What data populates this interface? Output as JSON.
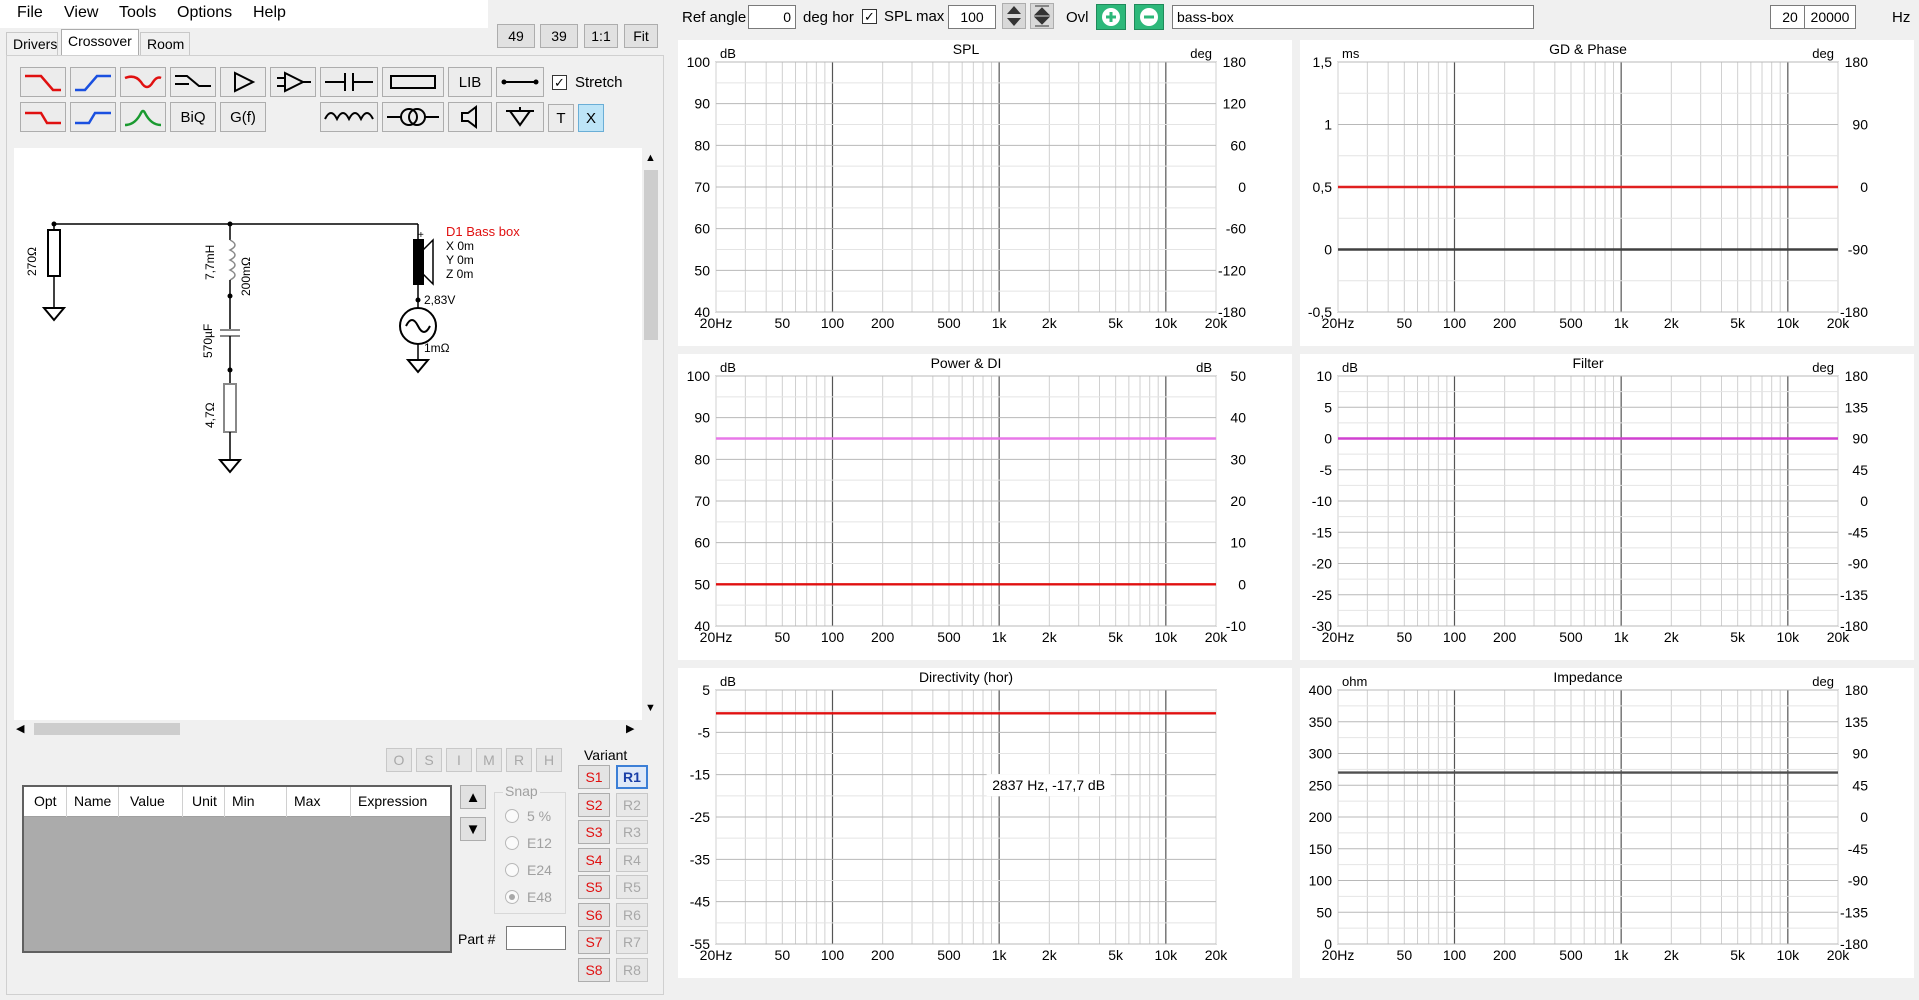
{
  "menu": {
    "file": "File",
    "view": "View",
    "tools": "Tools",
    "options": "Options",
    "help": "Help"
  },
  "tabs": {
    "drivers": "Drivers",
    "crossover": "Crossover",
    "room": "Room"
  },
  "zoom": {
    "z49": "49",
    "z39": "39",
    "one": "1:1",
    "fit": "Fit"
  },
  "toolbar": {
    "lib": "LIB",
    "biq": "BiQ",
    "gf": "G(f)",
    "stretch": "Stretch",
    "t": "T",
    "x": "X"
  },
  "schematic": {
    "r1": "270Ω",
    "l1": "7,7mH",
    "l1_res": "200mΩ",
    "c1": "570µF",
    "r2": "4,7Ω",
    "driver_name": "D1 Bass box",
    "x": "X 0m",
    "y": "Y 0m",
    "z": "Z 0m",
    "voltage": "2,83V",
    "src_res": "1mΩ",
    "colors": {
      "driver": "#e01010",
      "wire": "#000000"
    }
  },
  "opt_buttons": [
    "O",
    "S",
    "I",
    "M",
    "R",
    "H"
  ],
  "opt_table": {
    "headers": [
      "Opt",
      "Name",
      "Value",
      "Unit",
      "Min",
      "Max",
      "Expression"
    ]
  },
  "variant": {
    "label": "Variant",
    "s": [
      "S1",
      "S2",
      "S3",
      "S4",
      "S5",
      "S6",
      "S7",
      "S8"
    ],
    "r": [
      "R1",
      "R2",
      "R3",
      "R4",
      "R5",
      "R6",
      "R7",
      "R8"
    ]
  },
  "snap": {
    "label": "Snap",
    "options": [
      "5 %",
      "E12",
      "E24",
      "E48"
    ],
    "selected": "E48"
  },
  "part": {
    "label": "Part #",
    "value": ""
  },
  "header": {
    "ref_angle_label": "Ref angle",
    "ref_angle": "0",
    "deg_hor": "deg hor",
    "spl_max_label": "SPL max",
    "spl_max": "100",
    "ovl_label": "Ovl",
    "overlay_name": "bass-box",
    "f_min": "20",
    "ellipsis": "...",
    "f_max": "20000",
    "hz": "Hz"
  },
  "x_ticks": [
    "20Hz",
    "50",
    "100",
    "200",
    "500",
    "1k",
    "2k",
    "5k",
    "10k",
    "20k"
  ],
  "chart_data": [
    {
      "type": "line",
      "title": "SPL",
      "unit_left": "dB",
      "unit_right": "deg",
      "xlim": [
        20,
        20000
      ],
      "xscale": "log",
      "ylim": [
        40,
        100
      ],
      "y2lim": [
        -180,
        180
      ],
      "yticks": [
        "100",
        "90",
        "80",
        "70",
        "60",
        "50",
        "40"
      ],
      "y2ticks": [
        "180",
        "120",
        "60",
        "0",
        "-60",
        "-120",
        "-180"
      ],
      "series": []
    },
    {
      "type": "line",
      "title": "GD & Phase",
      "unit_left": "ms",
      "unit_right": "deg",
      "xlim": [
        20,
        20000
      ],
      "xscale": "log",
      "ylim": [
        -0.5,
        1.5
      ],
      "y2lim": [
        -180,
        180
      ],
      "yticks": [
        "1,5",
        "1",
        "0,5",
        "0",
        "-0,5"
      ],
      "y2ticks": [
        "180",
        "90",
        "0",
        "-90",
        "-180"
      ],
      "series": [
        {
          "color": "#e02020",
          "axis": "left",
          "x": [
            20,
            20000
          ],
          "y": [
            0.5,
            0.5
          ]
        },
        {
          "color": "#404040",
          "axis": "left",
          "x": [
            20,
            20000
          ],
          "y": [
            0,
            0
          ]
        }
      ]
    },
    {
      "type": "line",
      "title": "Power & DI",
      "unit_left": "dB",
      "unit_right": "dB",
      "xlim": [
        20,
        20000
      ],
      "xscale": "log",
      "ylim": [
        40,
        100
      ],
      "y2lim": [
        -10,
        50
      ],
      "yticks": [
        "100",
        "90",
        "80",
        "70",
        "60",
        "50",
        "40"
      ],
      "y2ticks": [
        "50",
        "40",
        "30",
        "20",
        "10",
        "0",
        "-10"
      ],
      "series": [
        {
          "color": "#e878e8",
          "axis": "left",
          "x": [
            20,
            20000
          ],
          "y": [
            85,
            85
          ]
        },
        {
          "color": "#e01010",
          "axis": "left",
          "x": [
            20,
            20000
          ],
          "y": [
            50,
            50
          ]
        }
      ]
    },
    {
      "type": "line",
      "title": "Filter",
      "unit_left": "dB",
      "unit_right": "deg",
      "xlim": [
        20,
        20000
      ],
      "xscale": "log",
      "ylim": [
        -30,
        10
      ],
      "y2lim": [
        -180,
        180
      ],
      "yticks": [
        "10",
        "5",
        "0",
        "-5",
        "-10",
        "-15",
        "-20",
        "-25",
        "-30"
      ],
      "y2ticks": [
        "180",
        "135",
        "90",
        "45",
        "0",
        "-45",
        "-90",
        "-135",
        "-180"
      ],
      "series": [
        {
          "color": "#d040d0",
          "axis": "left",
          "x": [
            20,
            20000
          ],
          "y": [
            0,
            0
          ]
        }
      ]
    },
    {
      "type": "line",
      "title": "Directivity (hor)",
      "unit_left": "dB",
      "unit_right": "",
      "xlim": [
        20,
        20000
      ],
      "xscale": "log",
      "ylim": [
        -55,
        5
      ],
      "y2lim": null,
      "yticks": [
        "5",
        "-5",
        "-15",
        "-25",
        "-35",
        "-45",
        "-55"
      ],
      "y2ticks": [],
      "annotation": "2837 Hz, -17,7 dB",
      "series": [
        {
          "color": "#e01010",
          "axis": "left",
          "x": [
            20,
            20000
          ],
          "y": [
            -0.5,
            -0.5
          ]
        }
      ]
    },
    {
      "type": "line",
      "title": "Impedance",
      "unit_left": "ohm",
      "unit_right": "deg",
      "xlim": [
        20,
        20000
      ],
      "xscale": "log",
      "ylim": [
        0,
        400
      ],
      "y2lim": [
        -180,
        180
      ],
      "yticks": [
        "400",
        "350",
        "300",
        "250",
        "200",
        "150",
        "100",
        "50",
        "0"
      ],
      "y2ticks": [
        "180",
        "135",
        "90",
        "45",
        "0",
        "-45",
        "-90",
        "-135",
        "-180"
      ],
      "series": [
        {
          "color": "#505050",
          "axis": "left",
          "x": [
            20,
            20000
          ],
          "y": [
            270,
            270
          ]
        }
      ]
    }
  ]
}
